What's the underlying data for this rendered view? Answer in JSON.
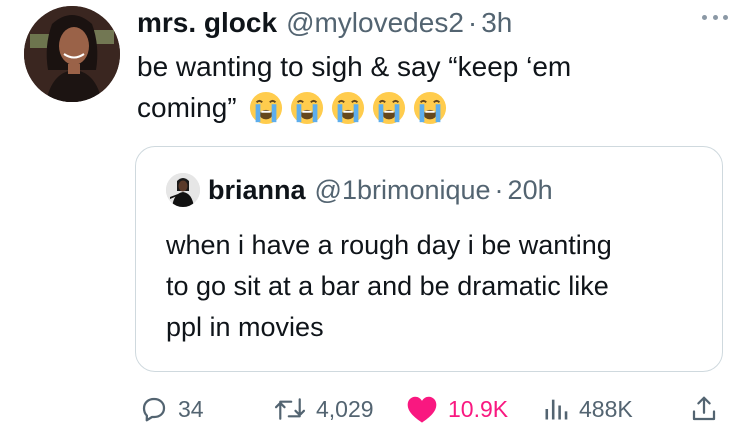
{
  "tweet": {
    "author": {
      "display_name": "mrs. glock",
      "handle": "@mylovedes2",
      "separator": "·",
      "time": "3h"
    },
    "text_line1": "be wanting to sigh & say “keep ‘em",
    "text_line2": "coming”",
    "emojis": [
      "loudly-crying-face",
      "loudly-crying-face",
      "loudly-crying-face",
      "loudly-crying-face",
      "loudly-crying-face"
    ]
  },
  "quoted_tweet": {
    "display_name": "brianna",
    "handle": "@1brimonique",
    "separator": "·",
    "time": "20h",
    "text_lines": [
      "when i have a rough day i be wanting",
      "to go sit at a bar and be dramatic like",
      "ppl in movies"
    ]
  },
  "actions": {
    "replies": "34",
    "retweets": "4,029",
    "likes": "10.9K",
    "views": "488K",
    "icons": [
      "reply-icon",
      "retweet-icon",
      "heart-icon",
      "views-icon",
      "share-icon"
    ]
  },
  "colors": {
    "text": "#0f1419",
    "secondary": "#536471",
    "like_pink": "#f91880",
    "border": "#cfd9de"
  }
}
